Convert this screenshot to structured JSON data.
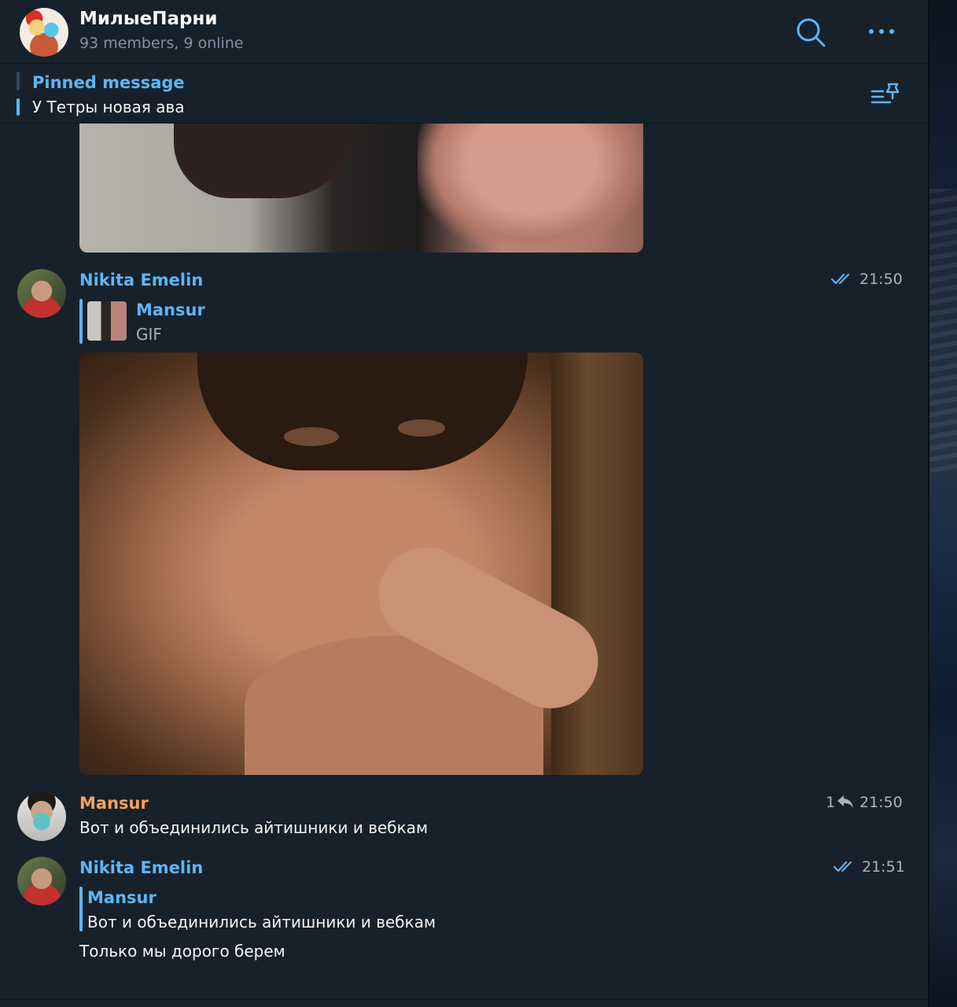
{
  "header": {
    "title": "МилыеПарни",
    "subtitle": "93 members, 9 online"
  },
  "pinned": {
    "label": "Pinned message",
    "text": "У Тетры новая ава"
  },
  "messages": [
    {
      "sender": "Nikita Emelin",
      "time": "21:50",
      "read": true,
      "reply": {
        "name": "Mansur",
        "text": "GIF"
      },
      "media": "gif"
    },
    {
      "sender": "Mansur",
      "time": "21:50",
      "replies_count": "1",
      "text": "Вот и объединились айтишники и вебкам"
    },
    {
      "sender": "Nikita Emelin",
      "time": "21:51",
      "read": true,
      "reply": {
        "name": "Mansur",
        "text": "Вот и объединились айтишники и вебкам"
      },
      "text": "Только мы дорого берем"
    }
  ],
  "colors": {
    "background": "#17212b",
    "accent": "#5eb5f7",
    "sender_orange": "#f5a35a",
    "muted": "#7f91a4"
  }
}
